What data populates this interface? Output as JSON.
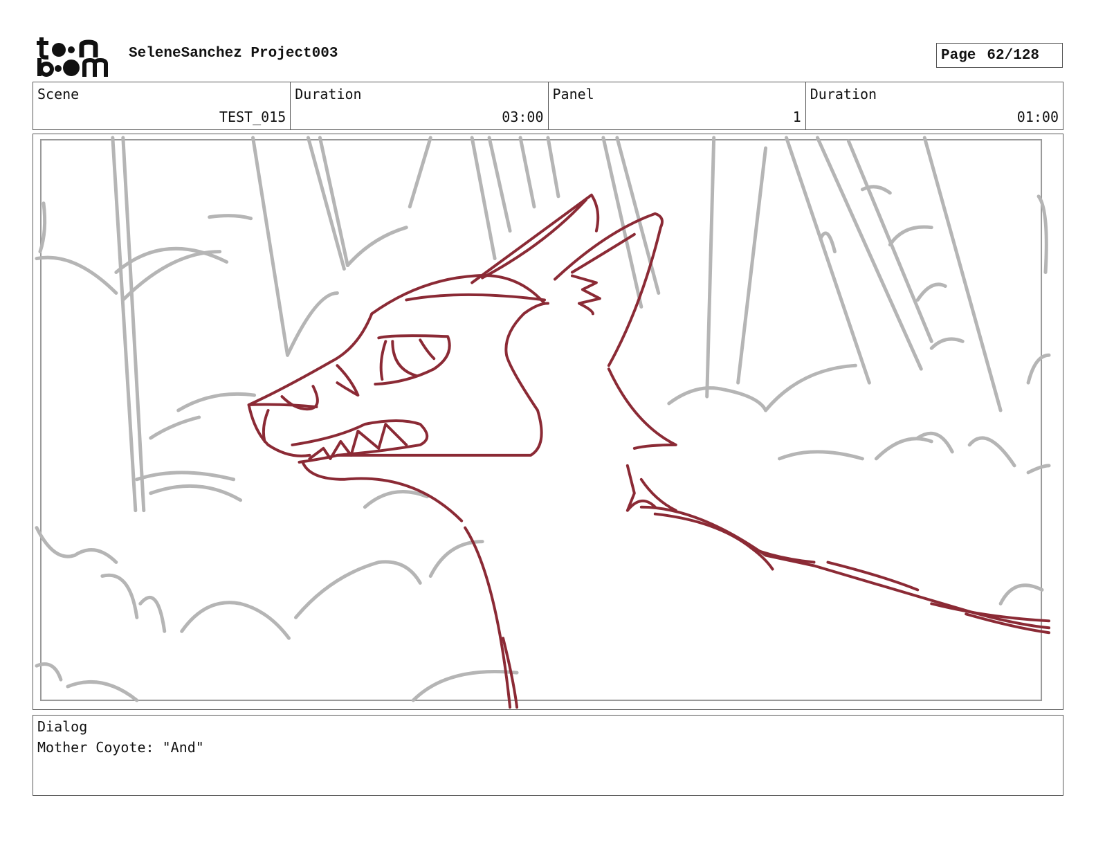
{
  "header": {
    "logo_icon": "toon-boom-logo",
    "project_title": "SeleneSanchez Project003",
    "page": {
      "label": "Page",
      "value": "62/128"
    }
  },
  "info": {
    "scene": {
      "label": "Scene",
      "value": "TEST_015"
    },
    "scene_duration": {
      "label": "Duration",
      "value": "03:00"
    },
    "panel": {
      "label": "Panel",
      "value": "1"
    },
    "panel_duration": {
      "label": "Duration",
      "value": "01:00"
    }
  },
  "panel_image": {
    "icon": "coyote-sketch-illustration",
    "line_color": "#8b2a35",
    "background_line_color": "#b5b5b5"
  },
  "dialog": {
    "label": "Dialog",
    "text": "Mother Coyote: \"And\""
  }
}
